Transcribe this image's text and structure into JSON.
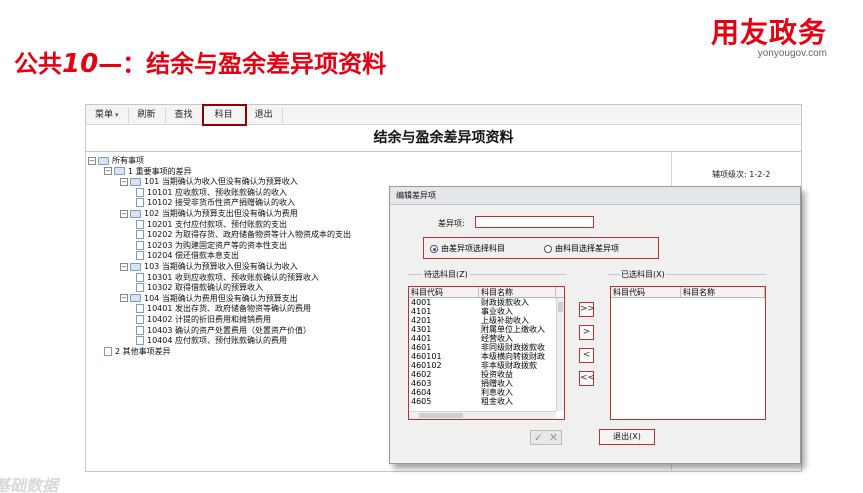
{
  "slide": {
    "title_prefix": "公共",
    "title_number": "10",
    "title_suffix": "—：结余与盈余差异项资料",
    "brand_logo": "用友政务",
    "brand_url": "yonyougov.com",
    "footer_watermark": "基础数据",
    "accent_color": "#e60012"
  },
  "toolbar": {
    "items": [
      {
        "label": "菜单",
        "has_caret": true
      },
      {
        "label": "刷新"
      },
      {
        "label": "查找"
      },
      {
        "label": "科目",
        "highlighted": true
      },
      {
        "label": "退出"
      }
    ]
  },
  "document": {
    "title": "结余与盈余差异项资料",
    "level_label": "辅项级次: 1-2-2"
  },
  "tree": [
    {
      "label": "所有事项",
      "level": 0,
      "type": "folder",
      "expanded": true
    },
    {
      "label": "1 重要事项的差异",
      "level": 1,
      "type": "folder",
      "expanded": true
    },
    {
      "label": "101 当期确认为收入但没有确认为预算收入",
      "level": 2,
      "type": "folder",
      "expanded": true
    },
    {
      "label": "10101 应收款项、预收账款确认的收入",
      "level": 3,
      "type": "doc"
    },
    {
      "label": "10102 接受非货币性资产捐赠确认的收入",
      "level": 3,
      "type": "doc"
    },
    {
      "label": "102 当期确认为预算支出但没有确认为费用",
      "level": 2,
      "type": "folder",
      "expanded": true
    },
    {
      "label": "10201 支付应付款项、预付账款的支出",
      "level": 3,
      "type": "doc"
    },
    {
      "label": "10202 为取得存货、政府储备物资等计入物资成本的支出",
      "level": 3,
      "type": "doc"
    },
    {
      "label": "10203 为购建固定资产等的资本性支出",
      "level": 3,
      "type": "doc"
    },
    {
      "label": "10204 偿还借款本息支出",
      "level": 3,
      "type": "doc"
    },
    {
      "label": "103 当期确认为预算收入但没有确认为收入",
      "level": 2,
      "type": "folder",
      "expanded": true
    },
    {
      "label": "10301 收到应收款项、预收账款确认的预算收入",
      "level": 3,
      "type": "doc"
    },
    {
      "label": "10302 取得借款确认的预算收入",
      "level": 3,
      "type": "doc"
    },
    {
      "label": "104 当期确认为费用但没有确认为预算支出",
      "level": 2,
      "type": "folder",
      "expanded": true
    },
    {
      "label": "10401 发出存货、政府储备物资等确认的费用",
      "level": 3,
      "type": "doc"
    },
    {
      "label": "10402 计提的折旧费用和摊销费用",
      "level": 3,
      "type": "doc"
    },
    {
      "label": "10403 确认的资产处置费用（处置资产价值）",
      "level": 3,
      "type": "doc"
    },
    {
      "label": "10404 应付款项、预付账款确认的费用",
      "level": 3,
      "type": "doc"
    },
    {
      "label": "2 其他事项差异",
      "level": 1,
      "type": "doc"
    }
  ],
  "dialog": {
    "title": "编辑差异项",
    "field_label": "差异项:",
    "field_value": "",
    "radio_options": [
      {
        "label": "由差异项选择科目",
        "selected": true
      },
      {
        "label": "由科目选择差异项",
        "selected": false
      }
    ],
    "left_group_label": "待选科目(Z)",
    "right_group_label": "已选科目(X)",
    "columns": [
      "科目代码",
      "科目名称"
    ],
    "left_rows": [
      [
        "4001",
        "财政拨款收入"
      ],
      [
        "4101",
        "事业收入"
      ],
      [
        "4201",
        "上级补助收入"
      ],
      [
        "4301",
        "附属单位上缴收入"
      ],
      [
        "4401",
        "经营收入"
      ],
      [
        "4601",
        "非同级财政拨款收"
      ],
      [
        "460101",
        "本级横向转拨财政"
      ],
      [
        "460102",
        "非本级财政拨款"
      ],
      [
        "4602",
        "投资收益"
      ],
      [
        "4603",
        "捐赠收入"
      ],
      [
        "4604",
        "利息收入"
      ],
      [
        "4605",
        "租金收入"
      ]
    ],
    "right_rows": [],
    "move_buttons": [
      ">>",
      ">",
      "<",
      "<<"
    ],
    "ok_glyph": "✓",
    "cancel_glyph": "✕",
    "exit_label": "退出(X)"
  }
}
